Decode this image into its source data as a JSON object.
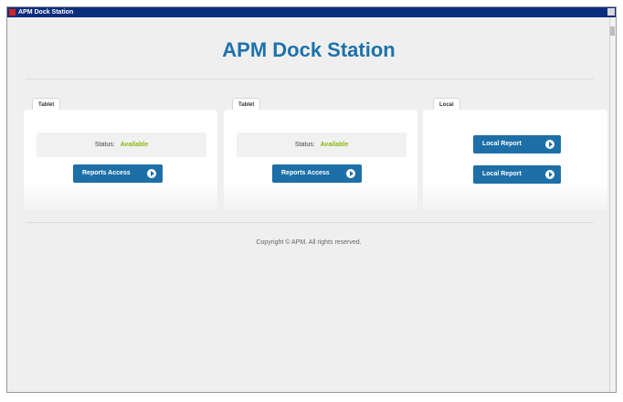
{
  "window": {
    "title": "APM Dock Station"
  },
  "page": {
    "title": "APM Dock Station"
  },
  "panels": [
    {
      "tab": "Tablet",
      "status_label": "Status:",
      "status_value": "Available",
      "button": "Reports Access"
    },
    {
      "tab": "Tablet",
      "status_label": "Status:",
      "status_value": "Available",
      "button": "Reports Access"
    },
    {
      "tab": "Local",
      "buttons": [
        "Local Report",
        "Local Report"
      ]
    }
  ],
  "footer": {
    "text": "Copyright © APM. All rights reserved."
  },
  "colors": {
    "accent": "#1d72aa",
    "button": "#1d6fa8",
    "status_ok": "#8ab70f",
    "titlebar": "#0b2d7e"
  }
}
